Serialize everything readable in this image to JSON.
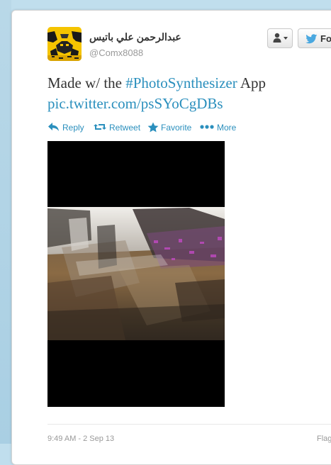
{
  "tweet": {
    "author": {
      "name": "عبدالرحمن علي باتيس",
      "screen_name": "@Comx8088"
    },
    "text_before": "Made w/ the ",
    "hashtag": "#PhotoSynthesizer",
    "text_after": " App",
    "pic_link": "pic.twitter.com/psSYoCgDBs",
    "timestamp": "9:49 AM - 2 Sep 13"
  },
  "header": {
    "follow_label": "Fo"
  },
  "actions": {
    "reply": "Reply",
    "retweet": "Retweet",
    "favorite": "Favorite",
    "more": "More"
  },
  "footer": {
    "flag_label": "Flag"
  },
  "colors": {
    "link": "#2a8fbd",
    "page_bg": "#c0deed",
    "avatar": "#f5c400"
  },
  "icons": {
    "user_dropdown": "person-icon",
    "follow": "twitter-bird-icon",
    "reply": "reply-arrow-icon",
    "retweet": "retweet-icon",
    "favorite": "star-icon",
    "more": "ellipsis-icon"
  }
}
